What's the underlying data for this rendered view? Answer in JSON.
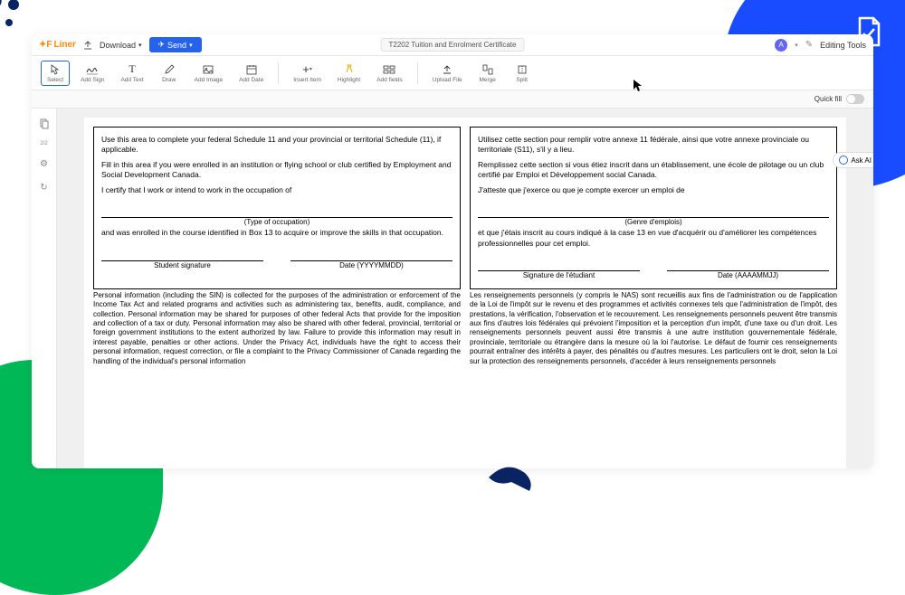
{
  "brand": "Liner",
  "download_label": "Download",
  "send_label": "Send",
  "doc_title": "T2202 Tuition and Enrolment Certificate",
  "avatar_letter": "A",
  "editing_tools_label": "Editing Tools",
  "quickfill_label": "Quick fill",
  "ask_ai_label": "Ask AI",
  "page_indicator": "2/2",
  "toolbar": {
    "select": "Select",
    "add_sign": "Add Sign",
    "add_text": "Add Text",
    "draw": "Draw",
    "add_image": "Add Image",
    "add_date": "Add Date",
    "insert_item": "Insert Item",
    "highlight": "Highlight",
    "add_fields": "Add fields",
    "upload_file": "Upload File",
    "merge": "Merge",
    "split": "Split"
  },
  "form": {
    "en": {
      "p1": "Use this area to complete your federal Schedule 11 and your provincial or territorial Schedule (11), if applicable.",
      "p2": "Fill in this area if you were enrolled in an institution or flying school or club certified by Employment and Social Development Canada.",
      "p3": "I certify that I work or intend to work in the occupation of",
      "type_label": "(Type of occupation)",
      "p4": "and was enrolled in the course identified in Box 13 to acquire or improve the skills in that occupation.",
      "sig_label": "Student signature",
      "date_label": "Date (YYYYMMDD)"
    },
    "fr": {
      "p1": "Utilisez cette section pour remplir votre annexe 11 fédérale, ainsi que votre annexe provinciale ou territoriale (S11), s'il y a lieu.",
      "p2": "Remplissez cette section si vous étiez inscrit dans un établissement, une école de pilotage ou un club certifié par Emploi et Développement social Canada.",
      "p3": "J'atteste que j'exerce ou que je compte exercer un emploi de",
      "type_label": "(Genre d'emplois)",
      "p4": "et que j'étais inscrit au cours indiqué à la case 13 en vue d'acquérir ou d'améliorer les compétences professionnelles pour cet emploi.",
      "sig_label": "Signature de l'étudiant",
      "date_label": "Date (AAAAMMJJ)"
    }
  },
  "privacy": {
    "en": "Personal information (including the SIN) is collected for the purposes of the administration or enforcement of the Income Tax Act and related programs and activities such as administering tax, benefits, audit, compliance, and collection. Personal information may be shared for purposes of other federal Acts that provide for the imposition and collection of a tax or duty. Personal information may also be shared with other federal, provincial, territorial or foreign government institutions to the extent authorized by law. Failure to provide this information may result in interest payable, penalties or other actions. Under the Privacy Act, individuals have the right to access their personal information, request correction, or file a complaint to the Privacy Commissioner of Canada regarding the handling of the individual's personal information",
    "fr": "Les renseignements personnels (y compris le NAS) sont recueillis aux fins de l'administration ou de l'application de la Loi de l'impôt sur le revenu et des programmes et activités connexes tels que l'administration de l'impôt, des prestations, la vérification, l'observation et le recouvrement. Les renseignements personnels peuvent être transmis aux fins d'autres lois fédérales qui prévoient l'imposition et la perception d'un impôt, d'une taxe ou d'un droit. Les renseignements personnels peuvent aussi être transmis à une autre institution gouvernementale fédérale, provinciale, territoriale ou étrangère dans la mesure où la loi l'autorise. Le défaut de fournir ces renseignements pourrait entraîner des intérêts à payer, des pénalités ou d'autres mesures. Les particuliers ont le droit, selon la Loi sur la protection des renseignements personnels, d'accéder à leurs renseignements personnels"
  }
}
